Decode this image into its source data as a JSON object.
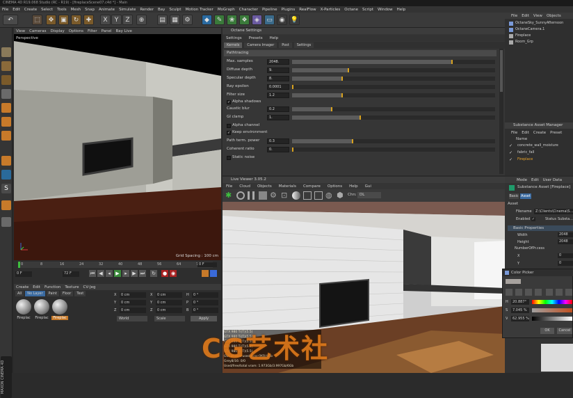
{
  "app": {
    "title": "CINEMA 4D R19.068 Studio (RC - R19) - [fireplaceScene07.c4d *] - Main"
  },
  "menu": [
    "File",
    "Edit",
    "Create",
    "Select",
    "Tools",
    "Mesh",
    "Snap",
    "Animate",
    "Simulate",
    "Render",
    "Bay",
    "Sculpt",
    "Motion Tracker",
    "MoGraph",
    "Character",
    "Pipeline",
    "Plugins",
    "RealFlow",
    "X-Particles",
    "Octane",
    "Script",
    "Window",
    "Help"
  ],
  "viewport": {
    "menu": [
      "View",
      "Cameras",
      "Display",
      "Options",
      "Filter",
      "Panel",
      "Bay Live"
    ],
    "label": "Perspective",
    "grid_spacing": "Grid Spacing : 100 cm"
  },
  "timeline": {
    "ticks": [
      "0",
      "8",
      "16",
      "24",
      "32",
      "40",
      "48",
      "56",
      "64",
      "70"
    ],
    "frame_start": "0 F",
    "frame_end": "72 F",
    "frame_field": "0 F",
    "frame_field2": "72 F"
  },
  "materials": {
    "menu": [
      "Create",
      "Edit",
      "Function",
      "Texture",
      "CV-Jeg"
    ],
    "filters": [
      "All",
      "No Layer",
      "Paint",
      "Floor",
      "Test"
    ],
    "items": [
      "Fireplac",
      "Fireplac",
      "Fireplac"
    ]
  },
  "coords": {
    "rows": [
      {
        "a": "X",
        "av": "0 cm",
        "b": "X",
        "bv": "0 cm",
        "c": "H",
        "cv": "0 °"
      },
      {
        "a": "Y",
        "av": "0 cm",
        "b": "Y",
        "bv": "0 cm",
        "c": "P",
        "cv": "0 °"
      },
      {
        "a": "Z",
        "av": "0 cm",
        "b": "Z",
        "bv": "0 cm",
        "c": "B",
        "cv": "0 °"
      }
    ],
    "mode1": "World",
    "mode2": "Scale",
    "apply": "Apply"
  },
  "octane_settings": {
    "title": "Octane Settings",
    "menu": [
      "Settings",
      "Presets",
      "Help"
    ],
    "tabs": [
      "Kernels",
      "Camera Imager",
      "Post",
      "Settings"
    ],
    "kernel": "Pathtracing",
    "params": [
      {
        "label": "Max. samples",
        "value": "2048.",
        "fill": 0.79
      },
      {
        "label": "Diffuse depth",
        "value": "9.",
        "fill": 0.28
      },
      {
        "label": "Specular depth",
        "value": "8.",
        "fill": 0.25
      },
      {
        "label": "Ray epsilon",
        "value": "0.0001",
        "fill": 0.0
      },
      {
        "label": "Filter size",
        "value": "1.2",
        "fill": 0.25
      },
      {
        "label": "Alpha shadows",
        "value": "",
        "fill": null
      },
      {
        "label": "Caustic blur",
        "value": "0.2",
        "fill": 0.2
      },
      {
        "label": "GI clamp",
        "value": "1.",
        "fill": 0.34
      },
      {
        "label": "Alpha channel",
        "value": "",
        "fill": null
      },
      {
        "label": "Keep environment",
        "value": "",
        "fill": null
      },
      {
        "label": "Path term. power",
        "value": "0.3",
        "fill": 0.3
      },
      {
        "label": "Coherent ratio",
        "value": "0.",
        "fill": 0.0
      },
      {
        "label": "Static noise",
        "value": "",
        "fill": null
      }
    ]
  },
  "live_viewer": {
    "title": "Live Viewer 3.05.2",
    "menu": [
      "File",
      "Cloud",
      "Objects",
      "Materials",
      "Compare",
      "Options",
      "Help",
      "Gui"
    ],
    "channel_label": "Chn:",
    "channel": "DL",
    "stats": [
      "GTX 980 Ti(T)(5.5)",
      "GTX 980 Ti(T)(5.5)",
      "GTX 980 Ti(T)(5.5)",
      "GTX 980 Ti(T)(5.5)",
      "GTX 980 Ti(T)(5.5)",
      "Out of core used/max:0KB/4Gb",
      "Grey8/16:  0/0",
      "Used/free/total vram: 1.973Gb/3.997Gb/6Gb"
    ]
  },
  "objects": {
    "menu": [
      "File",
      "Edit",
      "View",
      "Objects"
    ],
    "items": [
      "OctaneSky_SunnyAfternoon",
      "OctaneCamera.1",
      "Fireplace",
      "Room_Grp"
    ]
  },
  "substance": {
    "title": "Substance Asset Manager",
    "menu": [
      "File",
      "Edit",
      "Create",
      "Preset"
    ],
    "col": "Name",
    "items": [
      "concrete_wall_moisture",
      "fabric_fall",
      "Fireplace"
    ]
  },
  "attributes": {
    "menu": [
      "Mode",
      "Edit",
      "User Data"
    ],
    "asset_title": "Substance Asset [Fireplace]",
    "tabs": [
      "Basic",
      "Asset"
    ],
    "section": "Asset",
    "filename_label": "Filename",
    "filename": "Z:\\Clients\\Cinema\\S...",
    "enabled": "Enabled",
    "status": "Status",
    "status_val": "Substa...",
    "basic_props": "Basic Properties",
    "width_label": "Width",
    "width": "2048",
    "height_label": "Height",
    "height": "2048",
    "outputs": "NumberOfPr.cess",
    "x": "X",
    "xv": "0",
    "y": "Y",
    "yv": "0"
  },
  "color_picker": {
    "title": "Color Picker",
    "h_label": "H",
    "h": "20.887°",
    "s_label": "S",
    "s": "7.045 %",
    "v_label": "V",
    "v": "62.955 %",
    "ok": "OK",
    "cancel": "Cancel"
  },
  "watermark": "CG艺术社",
  "colors": {
    "accent": "#e9a32a",
    "panel": "#363636",
    "dark": "#2b2b2b"
  }
}
